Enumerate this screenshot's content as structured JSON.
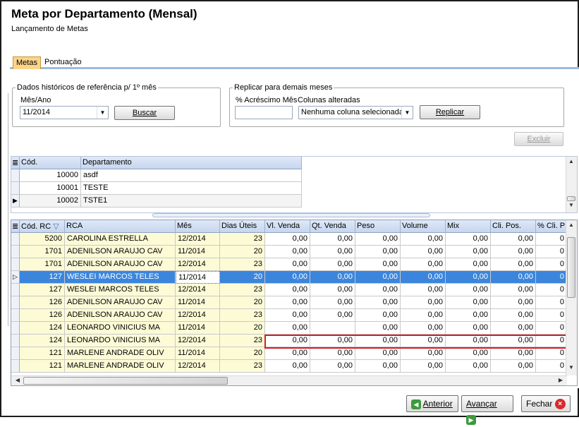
{
  "window": {
    "title": "Meta por Departamento (Mensal)",
    "subtitle": "Lançamento de Metas"
  },
  "tabs": [
    "Metas",
    "Pontuação"
  ],
  "historico": {
    "legend": "Dados históricos de referência p/ 1º mês",
    "mes_ano_label": "Mês/Ano",
    "mes_ano_value": "11/2014",
    "buscar_label": "Buscar"
  },
  "replicar": {
    "legend": "Replicar para demais meses",
    "acrescimo_label": "% Acréscimo Mês",
    "acrescimo_value": "",
    "colunas_label": "Colunas alteradas",
    "colunas_value": "Nenhuma coluna selecionada",
    "replicar_label": "Replicar"
  },
  "excluir_label": "Excluir",
  "dept_grid": {
    "headers": [
      "Cód.",
      "Departamento"
    ],
    "rows": [
      {
        "cod": "10000",
        "dep": "asdf"
      },
      {
        "cod": "10001",
        "dep": "TESTE"
      },
      {
        "cod": "10002",
        "dep": "TSTE1"
      }
    ]
  },
  "meta_grid": {
    "headers": [
      "Cód. RC",
      "RCA",
      "Mês",
      "Dias Úteis",
      "Vl. Venda",
      "Qt. Venda",
      "Peso",
      "Volume",
      "Mix",
      "Cli. Pos.",
      "% Cli. P"
    ],
    "rows": [
      {
        "cod": "5200",
        "rca": "CAROLINA ESTRELLA",
        "mes": "12/2014",
        "dias": "23",
        "vals": [
          "0,00",
          "0,00",
          "0,00",
          "0,00",
          "0,00",
          "0,00",
          "0"
        ]
      },
      {
        "cod": "1701",
        "rca": "ADENILSON ARAUJO CAV",
        "mes": "11/2014",
        "dias": "20",
        "vals": [
          "0,00",
          "0,00",
          "0,00",
          "0,00",
          "0,00",
          "0,00",
          "0"
        ]
      },
      {
        "cod": "1701",
        "rca": "ADENILSON ARAUJO CAV",
        "mes": "12/2014",
        "dias": "23",
        "vals": [
          "0,00",
          "0,00",
          "0,00",
          "0,00",
          "0,00",
          "0,00",
          "0"
        ]
      },
      {
        "cod": "127",
        "rca": "WESLEI MARCOS TELES",
        "mes": "11/2014",
        "dias": "20",
        "vals": [
          "0,00",
          "0,00",
          "0,00",
          "0,00",
          "0,00",
          "0,00",
          "0"
        ]
      },
      {
        "cod": "127",
        "rca": "WESLEI MARCOS TELES",
        "mes": "12/2014",
        "dias": "23",
        "vals": [
          "0,00",
          "0,00",
          "0,00",
          "0,00",
          "0,00",
          "0,00",
          "0"
        ]
      },
      {
        "cod": "126",
        "rca": "ADENILSON ARAUJO CAV",
        "mes": "11/2014",
        "dias": "20",
        "vals": [
          "0,00",
          "0,00",
          "0,00",
          "0,00",
          "0,00",
          "0,00",
          "0"
        ]
      },
      {
        "cod": "126",
        "rca": "ADENILSON ARAUJO CAV",
        "mes": "12/2014",
        "dias": "23",
        "vals": [
          "0,00",
          "0,00",
          "0,00",
          "0,00",
          "0,00",
          "0,00",
          "0"
        ]
      },
      {
        "cod": "124",
        "rca": "LEONARDO VINICIUS MA",
        "mes": "11/2014",
        "dias": "20",
        "vals": [
          "0,00",
          "",
          "0,00",
          "0,00",
          "0,00",
          "0,00",
          "0"
        ]
      },
      {
        "cod": "124",
        "rca": "LEONARDO VINICIUS MA",
        "mes": "12/2014",
        "dias": "23",
        "vals": [
          "0,00",
          "0,00",
          "0,00",
          "0,00",
          "0,00",
          "0,00",
          "0"
        ]
      },
      {
        "cod": "121",
        "rca": "MARLENE ANDRADE OLIV",
        "mes": "11/2014",
        "dias": "20",
        "vals": [
          "0,00",
          "0,00",
          "0,00",
          "0,00",
          "0,00",
          "0,00",
          "0"
        ]
      },
      {
        "cod": "121",
        "rca": "MARLENE ANDRADE OLIV",
        "mes": "12/2014",
        "dias": "23",
        "vals": [
          "0,00",
          "0,00",
          "0,00",
          "0,00",
          "0,00",
          "0,00",
          "0"
        ]
      }
    ]
  },
  "footer": {
    "anterior": "Anterior",
    "avancar": "Avançar",
    "fechar": "Fechar"
  },
  "colors": {
    "yellow_cell": "#fdfbd6",
    "selected_row": "#3b86dc",
    "highlight_border": "#d21d2d"
  }
}
